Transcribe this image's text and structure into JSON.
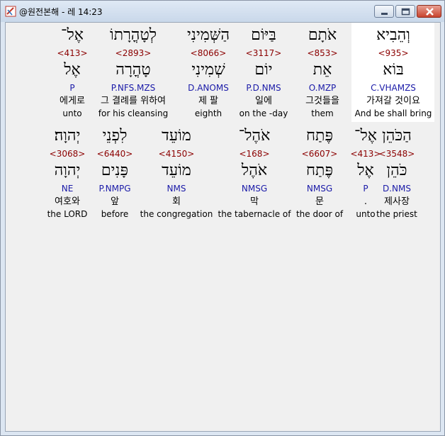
{
  "window": {
    "title": "@원전본해 - 레 14:23"
  },
  "rows": [
    {
      "words": [
        {
          "hebrew": "וְהֵבִיא",
          "strong": "<935>",
          "lemma": "בּוֹא",
          "parse": "C.VHAMZS",
          "korean": "가져갈 것이요",
          "english": "And be shall bring",
          "selected": true
        },
        {
          "hebrew": "אֹתָם",
          "strong": "<853>",
          "lemma": "אֵת",
          "parse": "O.MZP",
          "korean": "그것들을",
          "english": "them"
        },
        {
          "hebrew": "בַּיּוֹם",
          "strong": "<3117>",
          "lemma": "יוֹם",
          "parse": "P.D.NMS",
          "korean": "일에",
          "english": "on the -day"
        },
        {
          "hebrew": "הַשְּׁמִינִי",
          "strong": "<8066>",
          "lemma": "שְׁמִינִי",
          "parse": "D.ANOMS",
          "korean": "제 팔",
          "english": "eighth"
        },
        {
          "hebrew": "לְטָהֳרָתוֹ",
          "strong": "<2893>",
          "lemma": "טָהֳרָה",
          "parse": "P.NFS.MZS",
          "korean": "그 결례를 위하여",
          "english": "for his cleansing"
        },
        {
          "hebrew": "אֶל־",
          "strong": "<413>",
          "lemma": "אֶל",
          "parse": "P",
          "korean": "에게로",
          "english": "unto"
        }
      ]
    },
    {
      "words": [
        {
          "hebrew": "הַכֹּהֵן",
          "strong": "<3548>",
          "lemma": "כֹּהֵן",
          "parse": "D.NMS",
          "korean": "제사장",
          "english": "the priest"
        },
        {
          "hebrew": "אֶל־",
          "strong": "<413>",
          "lemma": "אֶל",
          "parse": "P",
          "korean": ".",
          "english": "unto"
        },
        {
          "hebrew": "פֶּתַח",
          "strong": "<6607>",
          "lemma": "פֶּתַח",
          "parse": "NMSG",
          "korean": "문",
          "english": "the door of"
        },
        {
          "hebrew": "אֹהֶל־",
          "strong": "<168>",
          "lemma": "אֹהֶל",
          "parse": "NMSG",
          "korean": "막",
          "english": "the tabernacle of"
        },
        {
          "hebrew": "מוֹעֵד",
          "strong": "<4150>",
          "lemma": "מוֹעֵד",
          "parse": "NMS",
          "korean": "회",
          "english": "the congregation"
        },
        {
          "hebrew": "לִפְנֵי",
          "strong": "<6440>",
          "lemma": "פָּנִים",
          "parse": "P.NMPG",
          "korean": "앞",
          "english": "before"
        },
        {
          "hebrew": "יְהוָה׃",
          "strong": "<3068>",
          "lemma": "יְהוָה",
          "parse": "NE",
          "korean": "여호와",
          "english": "the LORD"
        }
      ]
    }
  ]
}
